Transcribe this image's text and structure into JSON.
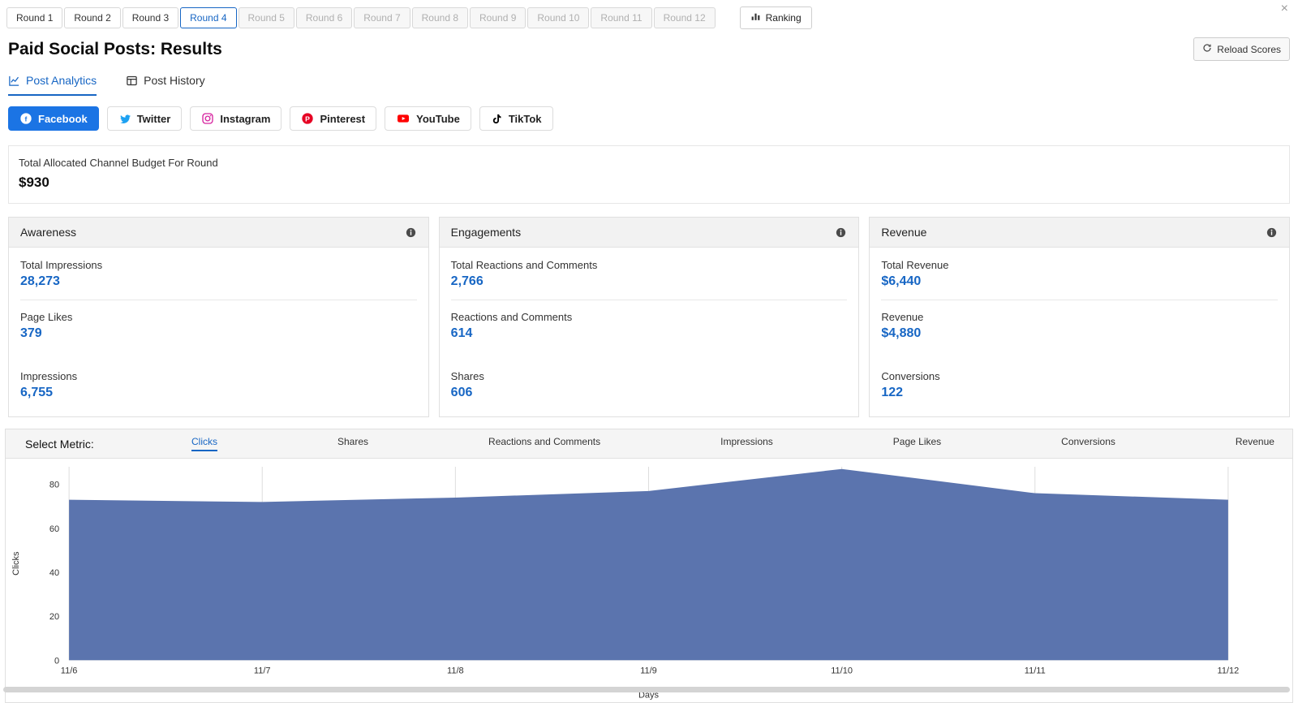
{
  "window": {
    "close_glyph": "×"
  },
  "rounds": {
    "tabs": [
      {
        "label": "Round 1",
        "state": "default"
      },
      {
        "label": "Round 2",
        "state": "default"
      },
      {
        "label": "Round 3",
        "state": "default"
      },
      {
        "label": "Round 4",
        "state": "active"
      },
      {
        "label": "Round 5",
        "state": "disabled"
      },
      {
        "label": "Round 6",
        "state": "disabled"
      },
      {
        "label": "Round 7",
        "state": "disabled"
      },
      {
        "label": "Round 8",
        "state": "disabled"
      },
      {
        "label": "Round 9",
        "state": "disabled"
      },
      {
        "label": "Round 10",
        "state": "disabled"
      },
      {
        "label": "Round 11",
        "state": "disabled"
      },
      {
        "label": "Round 12",
        "state": "disabled"
      }
    ],
    "ranking_label": "Ranking"
  },
  "header": {
    "title": "Paid Social Posts: Results",
    "reload_label": "Reload Scores"
  },
  "tabs": [
    {
      "label": "Post Analytics",
      "active": true
    },
    {
      "label": "Post History",
      "active": false
    }
  ],
  "channels": [
    {
      "label": "Facebook",
      "active": true
    },
    {
      "label": "Twitter",
      "active": false
    },
    {
      "label": "Instagram",
      "active": false
    },
    {
      "label": "Pinterest",
      "active": false
    },
    {
      "label": "YouTube",
      "active": false
    },
    {
      "label": "TikTok",
      "active": false
    }
  ],
  "budget": {
    "label": "Total Allocated Channel Budget For Round",
    "value": "$930"
  },
  "cards": [
    {
      "title": "Awareness",
      "metrics": [
        {
          "label": "Total Impressions",
          "value": "28,273"
        },
        {
          "label": "Page Likes",
          "value": "379"
        },
        {
          "label": "Impressions",
          "value": "6,755"
        }
      ]
    },
    {
      "title": "Engagements",
      "metrics": [
        {
          "label": "Total Reactions and Comments",
          "value": "2,766"
        },
        {
          "label": "Reactions and Comments",
          "value": "614"
        },
        {
          "label": "Shares",
          "value": "606"
        }
      ]
    },
    {
      "title": "Revenue",
      "metrics": [
        {
          "label": "Total Revenue",
          "value": "$6,440"
        },
        {
          "label": "Revenue",
          "value": "$4,880"
        },
        {
          "label": "Conversions",
          "value": "122"
        }
      ]
    }
  ],
  "metric_selector": {
    "label": "Select Metric:",
    "selected": "Clicks",
    "options": [
      "Clicks",
      "Shares",
      "Reactions and Comments",
      "Impressions",
      "Page Likes",
      "Conversions",
      "Revenue"
    ]
  },
  "chart_data": {
    "type": "area",
    "x": [
      "11/6",
      "11/7",
      "11/8",
      "11/9",
      "11/10",
      "11/11",
      "11/12"
    ],
    "series": [
      {
        "name": "Clicks",
        "values": [
          73,
          72,
          74,
          77,
          87,
          76,
          73
        ]
      }
    ],
    "xlabel": "Days",
    "ylabel": "Clicks",
    "ylim": [
      0,
      88
    ],
    "yticks": [
      0,
      20,
      40,
      60,
      80
    ],
    "grid": "vertical-only",
    "legend": false,
    "fill_color": "#5b74ae"
  },
  "colors": {
    "accent": "#1766c4",
    "facebook": "#1b74e4",
    "twitter": "#1da1f2",
    "instagram": "#d6249f",
    "pinterest": "#e60023",
    "youtube": "#ff0000",
    "tiktok": "#000000",
    "chart_fill": "#5b74ae"
  }
}
